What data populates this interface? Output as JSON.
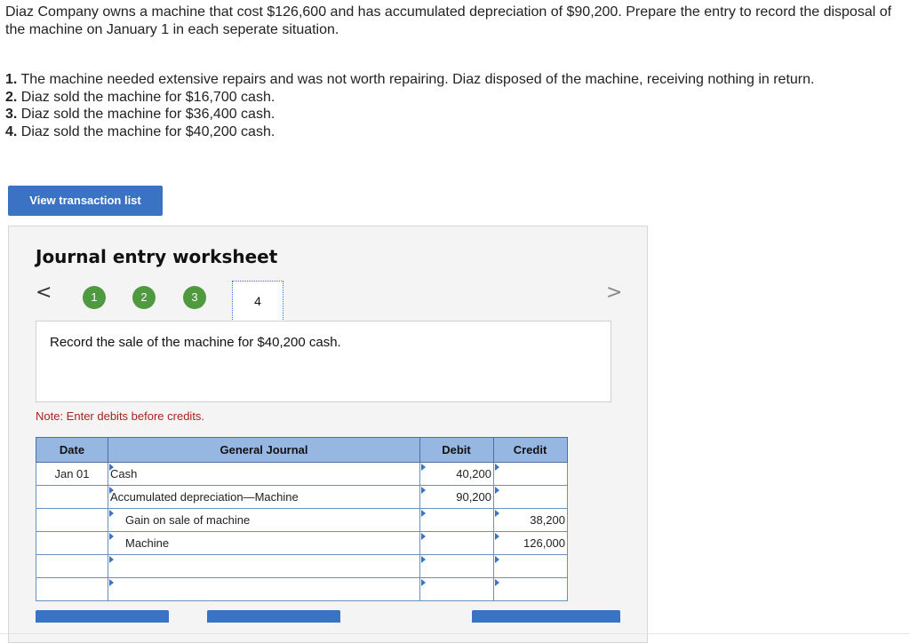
{
  "problem": {
    "intro": "Diaz Company owns a machine that cost $126,600 and has accumulated depreciation of $90,200. Prepare the entry to record the disposal of the machine on January 1 in each seperate situation.",
    "requirements": [
      {
        "num": "1.",
        "text": "The machine needed extensive repairs and was not worth repairing. Diaz disposed of the machine, receiving nothing in return."
      },
      {
        "num": "2.",
        "text": "Diaz sold the machine for $16,700 cash."
      },
      {
        "num": "3.",
        "text": "Diaz sold the machine for $36,400 cash."
      },
      {
        "num": "4.",
        "text": "Diaz sold the machine for $40,200 cash."
      }
    ]
  },
  "view_transaction_button": "View transaction list",
  "worksheet": {
    "title": "Journal entry worksheet",
    "prev_arrow": "<",
    "next_arrow": ">",
    "steps": [
      "1",
      "2",
      "3",
      "4"
    ],
    "current_step": "4",
    "prompt": "Record the sale of the machine for $40,200 cash.",
    "note": "Note: Enter debits before credits.",
    "headers": {
      "date": "Date",
      "account": "General Journal",
      "debit": "Debit",
      "credit": "Credit"
    },
    "rows": [
      {
        "date": "Jan 01",
        "account": "Cash",
        "debit": "40,200",
        "credit": ""
      },
      {
        "date": "",
        "account": "Accumulated depreciation—Machine",
        "debit": "90,200",
        "credit": ""
      },
      {
        "date": "",
        "account": "Gain on sale of machine",
        "debit": "",
        "credit": "38,200"
      },
      {
        "date": "",
        "account": "Machine",
        "debit": "",
        "credit": "126,000"
      },
      {
        "date": "",
        "account": "",
        "debit": "",
        "credit": ""
      },
      {
        "date": "",
        "account": "",
        "debit": "",
        "credit": ""
      }
    ]
  },
  "colors": {
    "accent": "#3b73c4",
    "step_done": "#4f9a3e",
    "note": "#a8231f",
    "header": "#97b7e3"
  }
}
